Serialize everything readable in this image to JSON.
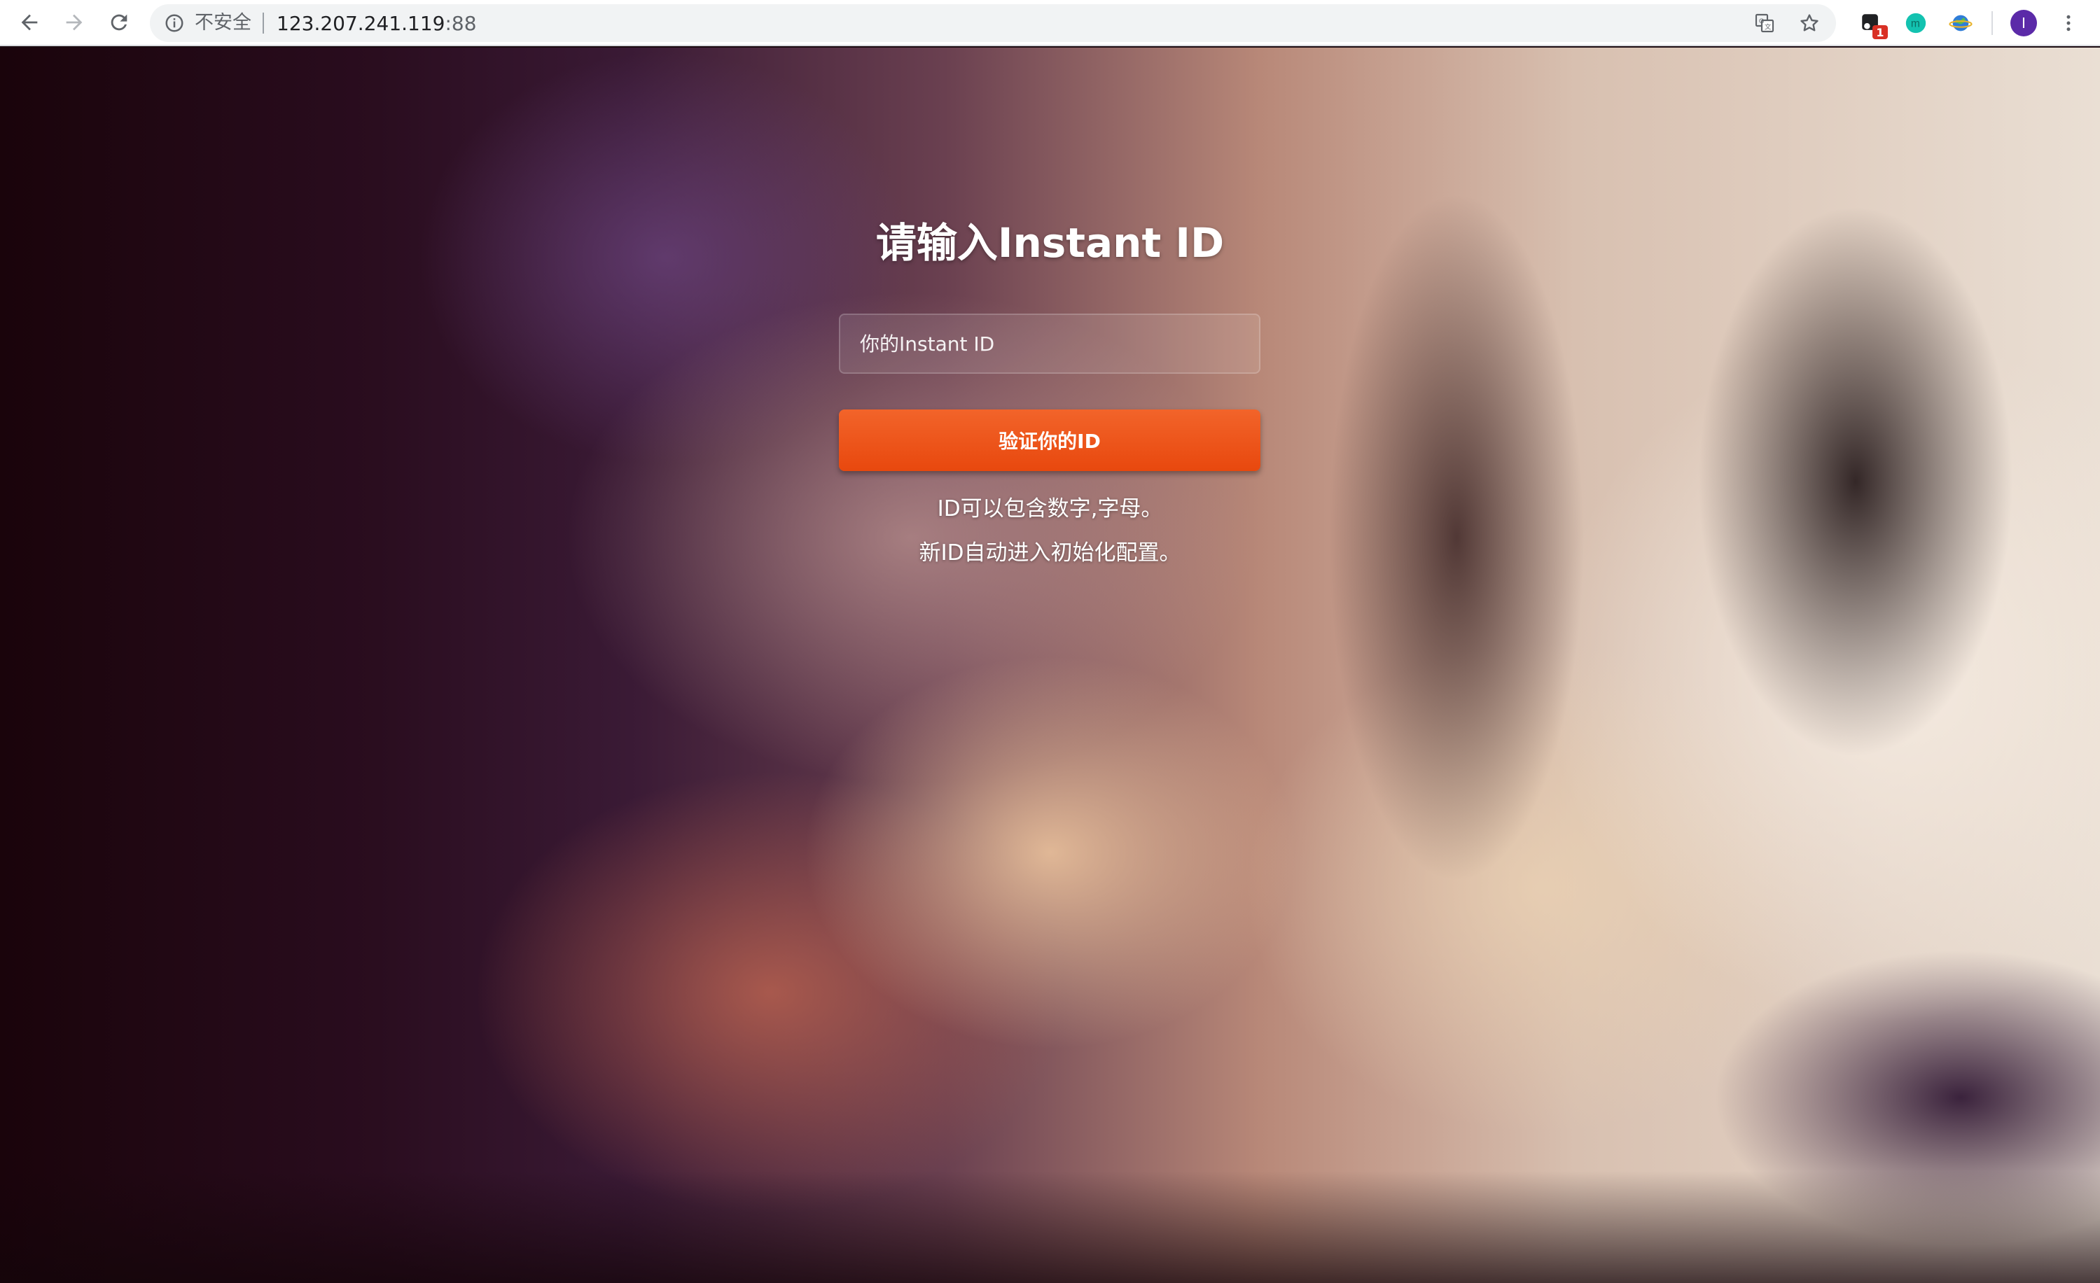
{
  "browser": {
    "security_label": "不安全",
    "url_host": "123.207.241.119",
    "url_port": ":88",
    "extension_badge": "1",
    "profile_initial": "I",
    "icons": [
      "back-icon",
      "forward-icon",
      "reload-icon",
      "info-icon",
      "translate-icon",
      "star-icon",
      "extension-icon",
      "extension-m-icon",
      "extension-globe-icon",
      "menu-icon"
    ]
  },
  "page": {
    "title": "请输入Instant ID",
    "input_placeholder": "你的Instant ID",
    "input_value": "",
    "verify_button": "验证你的ID",
    "hint_line1": "ID可以包含数字,字母。",
    "hint_line2": "新ID自动进入初始化配置。",
    "accent_color": "#e8480e"
  }
}
